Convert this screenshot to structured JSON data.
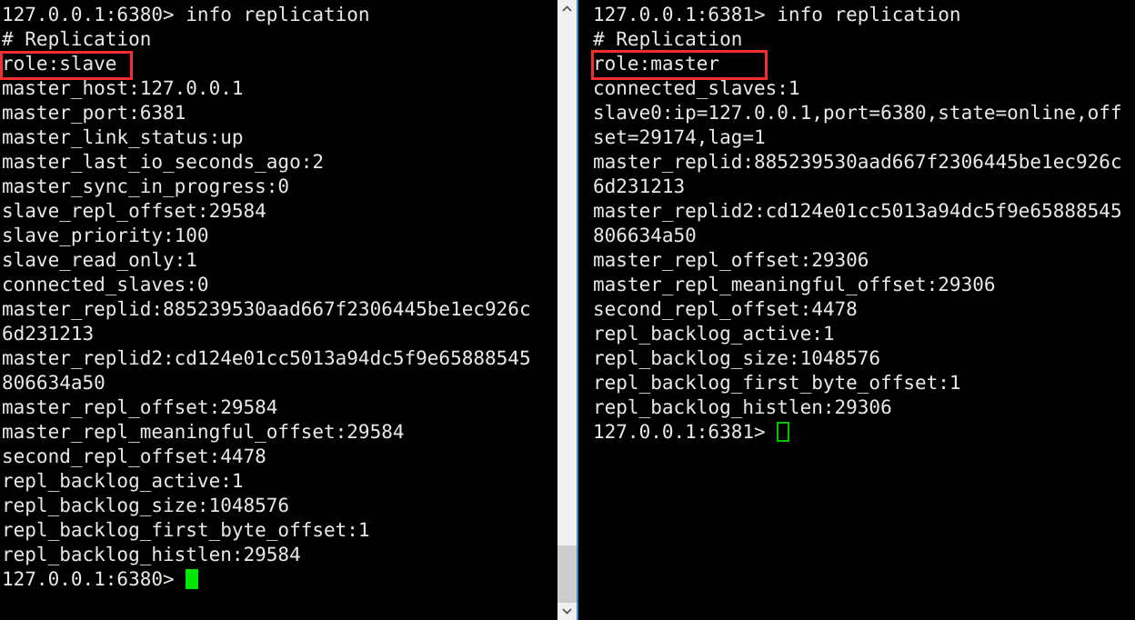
{
  "window": {
    "background_color": "#000000",
    "text_color": "#e8e8e8",
    "highlight_color": "#f42d2d",
    "cursor_color": "#00e800",
    "focus_border_color": "#3c82c8"
  },
  "left_terminal": {
    "name": "redis-cli-6380",
    "prompt": "127.0.0.1:6380>",
    "command": "info replication",
    "highlight_line": "role:slave",
    "cursor_style": "solid-block",
    "lines": [
      "127.0.0.1:6380> info replication",
      "# Replication",
      "role:slave",
      "master_host:127.0.0.1",
      "master_port:6381",
      "master_link_status:up",
      "master_last_io_seconds_ago:2",
      "master_sync_in_progress:0",
      "slave_repl_offset:29584",
      "slave_priority:100",
      "slave_read_only:1",
      "connected_slaves:0",
      "master_replid:885239530aad667f2306445be1ec926c",
      "6d231213",
      "master_replid2:cd124e01cc5013a94dc5f9e65888545",
      "806634a50",
      "master_repl_offset:29584",
      "master_repl_meaningful_offset:29584",
      "second_repl_offset:4478",
      "repl_backlog_active:1",
      "repl_backlog_size:1048576",
      "repl_backlog_first_byte_offset:1",
      "repl_backlog_histlen:29584"
    ],
    "prompt_line": "127.0.0.1:6380> "
  },
  "right_terminal": {
    "name": "redis-cli-6381",
    "prompt": "127.0.0.1:6381>",
    "command": "info replication",
    "highlight_line": "role:master",
    "cursor_style": "hollow-block",
    "lines": [
      "127.0.0.1:6381> info replication",
      "# Replication",
      "role:master",
      "connected_slaves:1",
      "slave0:ip=127.0.0.1,port=6380,state=online,off",
      "set=29174,lag=1",
      "master_replid:885239530aad667f2306445be1ec926c",
      "6d231213",
      "master_replid2:cd124e01cc5013a94dc5f9e65888545",
      "806634a50",
      "master_repl_offset:29306",
      "master_repl_meaningful_offset:29306",
      "second_repl_offset:4478",
      "repl_backlog_active:1",
      "repl_backlog_size:1048576",
      "repl_backlog_first_byte_offset:1",
      "repl_backlog_histlen:29306"
    ],
    "prompt_line": "127.0.0.1:6381> "
  },
  "scrollbar": {
    "name": "left-pane-scrollbar",
    "up_arrow_icon": "chevron-up-icon",
    "down_arrow_icon": "chevron-down-icon",
    "thumb_position": "bottom",
    "track_color": "#f0f0f0",
    "thumb_color": "#cdcdcd"
  }
}
